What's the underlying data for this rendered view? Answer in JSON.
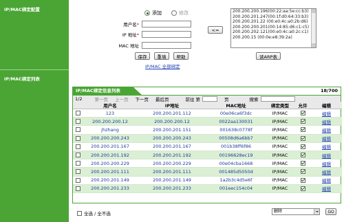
{
  "sidebar": {
    "section1_title": "IP/MAC绑定配置",
    "section2_title": "IP/MAC绑定列表"
  },
  "form": {
    "radio_add": "添加",
    "radio_modify": "修改",
    "username_label": "用户名",
    "ip_label": "IP 地址",
    "mac_label": "MAC 地址",
    "required_mark": "*",
    "username_value": "",
    "ip_value": "",
    "mac_value": "",
    "save_button": "保存",
    "reset_button": "重填",
    "help_button": "帮助",
    "bind_all_link": "IP/MAC 全部绑定",
    "copy_button": "<=",
    "read_arp_button": "读ARP表",
    "arp_list": [
      "200.200.200.196(00:22:aa:5e:cc:b3)",
      "200.200.201.247(00:1f:d0:64:33:b3)",
      "200.200.201.22 (00:e0:4c:a0:2b:d6)",
      "200.200.200.201(00:14:85:d6:c1:c5)",
      "200.200.202.121(00:e0:4c:a0:2c:c1)",
      "200.200.15 (00:0e:e8:39:2a)"
    ]
  },
  "table": {
    "title": "IP/MAC绑定信息列表",
    "count": "18/700",
    "pager": {
      "page": "1/2",
      "first": "第一页",
      "prev": "上一页",
      "next": "下一页",
      "last": "最后页",
      "goto_label": "前往 第",
      "page_unit": "页",
      "search_label": "搜索"
    },
    "columns": [
      "",
      "用户名",
      "IP地址",
      "MAC地址",
      "绑定类型",
      "允许",
      "编辑"
    ],
    "rows": [
      {
        "user": "123",
        "ip": "200.200.201.112",
        "mac": "00e06ca6f3dc",
        "type": "IP/MAC",
        "edit": "编辑"
      },
      {
        "user": "200.200.200.12",
        "ip": "200.200.200.12",
        "mac": "0022aa130031",
        "type": "IP/MAC",
        "edit": "编辑"
      },
      {
        "user": "jhzhang",
        "ip": "200.200.201.151",
        "mac": "001638c0778f",
        "type": "IP/MAC",
        "edit": "编辑"
      },
      {
        "user": "200.200.200.243",
        "ip": "200.200.200.243",
        "mac": "00508d6a6bb7",
        "type": "IP/MAC",
        "edit": "编辑"
      },
      {
        "user": "200.200.201.167",
        "ip": "200.200.201.167",
        "mac": "001b38ff6f86",
        "type": "IP/MAC",
        "edit": "编辑"
      },
      {
        "user": "200.200.201.192",
        "ip": "200.200.201.192",
        "mac": "00196628ec19",
        "type": "IP/MAC",
        "edit": "编辑"
      },
      {
        "user": "200.200.200.229",
        "ip": "200.200.200.229",
        "mac": "00e04cba1668",
        "type": "IP/MAC",
        "edit": "编辑"
      },
      {
        "user": "200.200.201.111",
        "ip": "200.200.201.111",
        "mac": "001485d5050d",
        "type": "IP/MAC",
        "edit": "编辑"
      },
      {
        "user": "200.200.201.149",
        "ip": "200.200.201.149",
        "mac": "1a2b3c4d5e6f",
        "type": "IP/MAC",
        "edit": "编辑"
      },
      {
        "user": "200.200.201.233",
        "ip": "200.200.201.233",
        "mac": "001eec154c04",
        "type": "IP/MAC",
        "edit": "编辑"
      }
    ]
  },
  "footer": {
    "select_all_label": "全选 / 全不选",
    "action_select": "删除",
    "go_button": "GO"
  },
  "colors": {
    "sidebar_green": "#4aa534",
    "row_alt_green": "#dbefd4",
    "link_blue": "#1e3fb0"
  }
}
